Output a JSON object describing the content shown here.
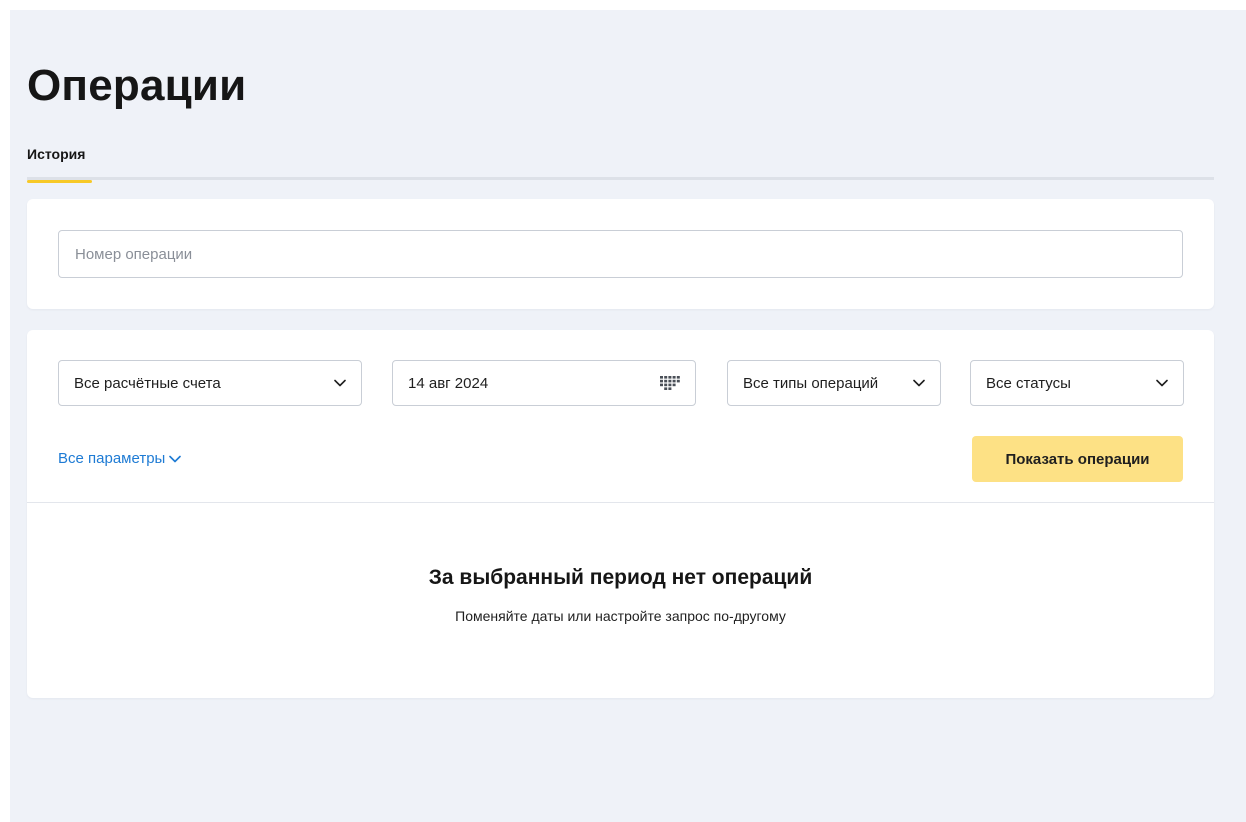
{
  "page": {
    "title": "Операции"
  },
  "tabs": [
    {
      "label": "История",
      "active": true
    }
  ],
  "search": {
    "placeholder": "Номер операции",
    "value": ""
  },
  "filters": {
    "accounts": {
      "value": "Все расчётные счета",
      "icon": "chevron-down-icon"
    },
    "date": {
      "value": "14 авг 2024",
      "icon": "calendar-icon"
    },
    "types": {
      "value": "Все типы операций",
      "icon": "chevron-down-icon"
    },
    "statuses": {
      "value": "Все статусы",
      "icon": "chevron-down-icon"
    },
    "all_params_link": "Все параметры",
    "show_button": "Показать операции"
  },
  "empty_state": {
    "title": "За выбранный период нет операций",
    "subtitle": "Поменяйте даты или настройте запрос по-другому"
  },
  "colors": {
    "background": "#eff2f8",
    "accent_yellow": "#f7c928",
    "button_yellow": "#fde185",
    "link_blue": "#1e7bd4"
  }
}
